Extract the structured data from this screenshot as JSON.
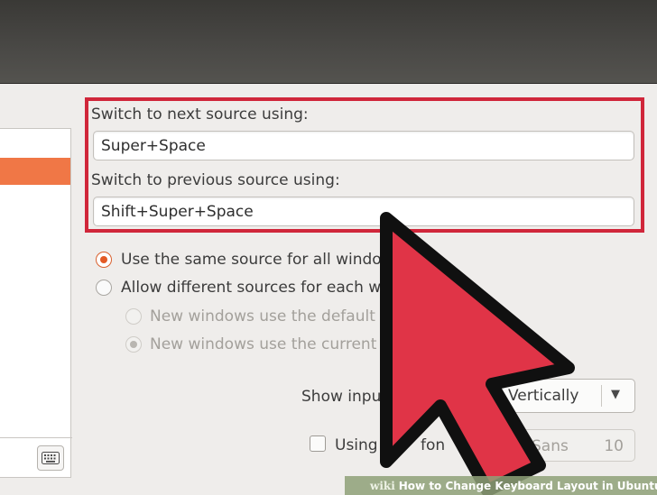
{
  "switching": {
    "next_label": "Switch to next source using:",
    "next_value": "Super+Space",
    "previous_label": "Switch to previous source using:",
    "previous_value": "Shift+Super+Space"
  },
  "options": {
    "same_source": "Use the same source for all windo",
    "different_sources": "Allow different sources for each w",
    "sub_default": "New windows use the default s",
    "sub_current": "New windows use the current s"
  },
  "indicator": {
    "label": "Show input",
    "value": "Vertically"
  },
  "custom_font": {
    "label": "Using cu",
    "label_tail": "fon",
    "font_name": "Sans",
    "font_size": "10"
  },
  "footer": {
    "brand": "wiki",
    "title": "How to Change Keyboard Layout in Ubuntu"
  },
  "colors": {
    "highlight": "#d0263a",
    "arrow_fill": "#e03447",
    "accent": "#f07746"
  }
}
